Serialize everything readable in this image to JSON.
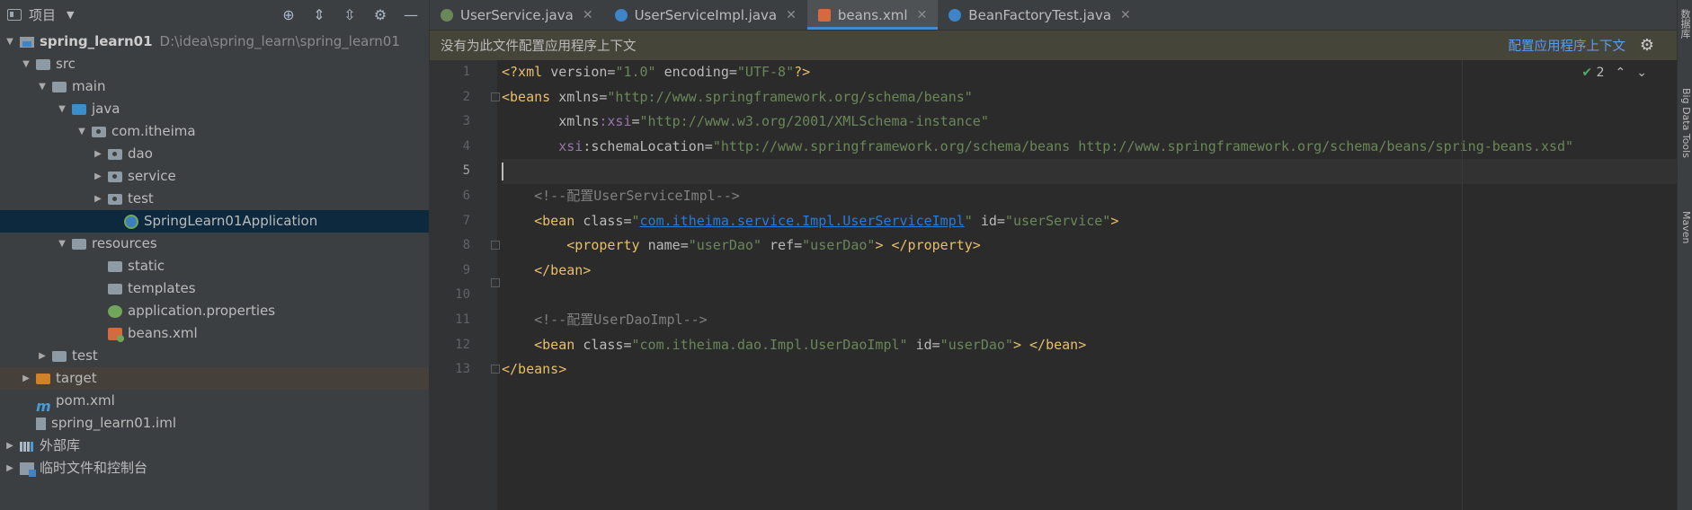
{
  "sidebar": {
    "title": "项目",
    "tree": [
      {
        "label": "spring_learn01",
        "path": "D:\\idea\\spring_learn\\spring_learn01"
      },
      {
        "label": "src"
      },
      {
        "label": "main"
      },
      {
        "label": "java"
      },
      {
        "label": "com.itheima"
      },
      {
        "label": "dao"
      },
      {
        "label": "service"
      },
      {
        "label": "test"
      },
      {
        "label": "SpringLearn01Application"
      },
      {
        "label": "resources"
      },
      {
        "label": "static"
      },
      {
        "label": "templates"
      },
      {
        "label": "application.properties"
      },
      {
        "label": "beans.xml"
      },
      {
        "label": "test"
      },
      {
        "label": "target"
      },
      {
        "label": "pom.xml"
      },
      {
        "label": "spring_learn01.iml"
      },
      {
        "label": "外部库"
      },
      {
        "label": "临时文件和控制台"
      }
    ]
  },
  "tabs": [
    {
      "label": "UserService.java"
    },
    {
      "label": "UserServiceImpl.java"
    },
    {
      "label": "beans.xml"
    },
    {
      "label": "BeanFactoryTest.java"
    }
  ],
  "notice": {
    "message": "没有为此文件配置应用程序上下文",
    "link": "配置应用程序上下文"
  },
  "inspection": {
    "count": "2"
  },
  "line_numbers": [
    "1",
    "2",
    "3",
    "4",
    "5",
    "6",
    "7",
    "8",
    "9",
    "10",
    "11",
    "12",
    "13"
  ],
  "code": {
    "l1": {
      "a": "<?xml ",
      "b": "version",
      "c": "=",
      "d": "\"1.0\"",
      "e": " encoding",
      "f": "=",
      "g": "\"UTF-8\"",
      "h": "?>"
    },
    "l2": {
      "a": "<beans ",
      "b": "xmlns",
      "c": "=",
      "d": "\"http://www.springframework.org/schema/beans\""
    },
    "l3": {
      "a": "       xmlns",
      "b": ":xsi",
      "c": "=",
      "d": "\"http://www.w3.org/2001/XMLSchema-instance\""
    },
    "l4": {
      "a": "       xsi",
      "b": ":schemaLocation",
      "c": "=",
      "d": "\"http://www.springframework.org/schema/beans http://www.springframework.org/schema/beans/spring-beans.xsd\""
    },
    "l6": "    <!--配置UserServiceImpl-->",
    "l7": {
      "a": "    <bean ",
      "b": "class",
      "c": "=",
      "d": "\"",
      "e": "com.itheima.service.Impl.UserServiceImpl",
      "f": "\"",
      "g": " id",
      "h": "=",
      "i": "\"userService\"",
      "j": ">"
    },
    "l8": {
      "a": "        <property ",
      "b": "name",
      "c": "=",
      "d": "\"userDao\"",
      "e": " ref",
      "f": "=",
      "g": "\"userDao\"",
      "h": "> </property>"
    },
    "l9": "    </bean>",
    "l11": "    <!--配置UserDaoImpl-->",
    "l12": {
      "a": "    <bean ",
      "b": "class",
      "c": "=",
      "d": "\"com.itheima.dao.Impl.UserDaoImpl\"",
      "e": " id",
      "f": "=",
      "g": "\"userDao\"",
      "h": "> </bean>"
    },
    "l13": "</beans>"
  },
  "right_strip": [
    "数据库",
    "Big Data Tools",
    "Maven"
  ]
}
